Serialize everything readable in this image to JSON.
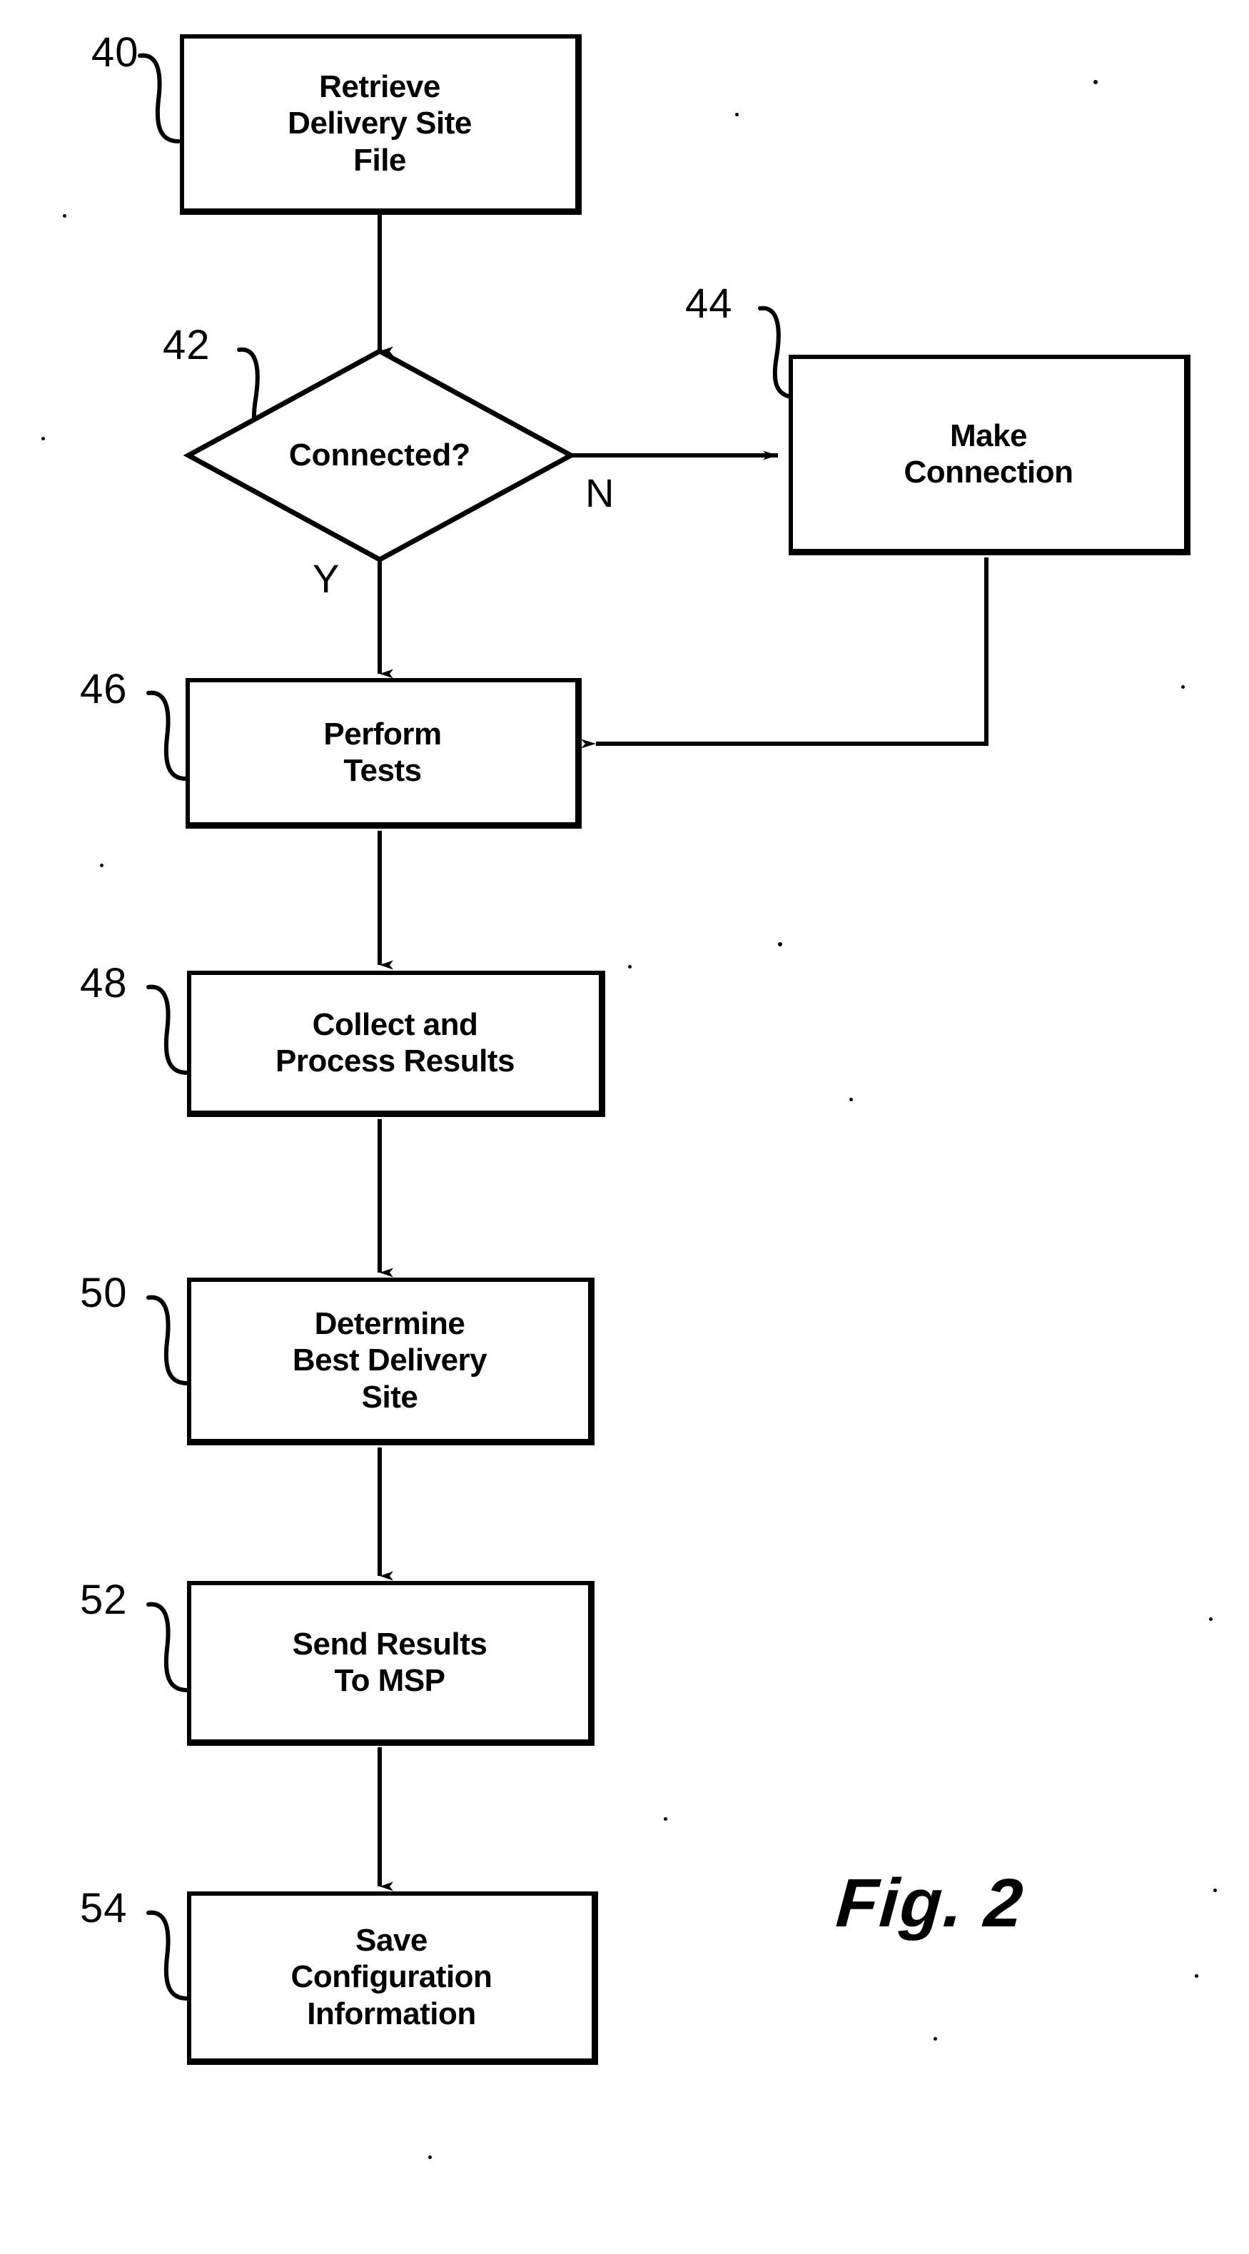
{
  "figure": {
    "caption": "Fig. 2",
    "type": "process flowchart",
    "background_color": "#ffffff",
    "ink_color": "#000000"
  },
  "nodes": [
    {
      "ref": "40",
      "shape": "process",
      "label": "Retrieve\nDelivery Site\nFile",
      "name": "retrieve-delivery-site-file"
    },
    {
      "ref": "42",
      "shape": "decision",
      "label": "Connected?",
      "name": "connected-decision"
    },
    {
      "ref": "44",
      "shape": "process",
      "label": "Make\nConnection",
      "name": "make-connection"
    },
    {
      "ref": "46",
      "shape": "process",
      "label": "Perform\nTests",
      "name": "perform-tests"
    },
    {
      "ref": "48",
      "shape": "process",
      "label": "Collect and\nProcess Results",
      "name": "collect-and-process-results"
    },
    {
      "ref": "50",
      "shape": "process",
      "label": "Determine\nBest Delivery\nSite",
      "name": "determine-best-delivery-site"
    },
    {
      "ref": "52",
      "shape": "process",
      "label": "Send Results\nTo MSP",
      "name": "send-results-to-msp"
    },
    {
      "ref": "54",
      "shape": "process",
      "label": "Save\nConfiguration\nInformation",
      "name": "save-configuration-information"
    }
  ],
  "branch_labels": {
    "yes": "Y",
    "no": "N"
  },
  "edges": [
    {
      "from": "40",
      "to": "42",
      "label": ""
    },
    {
      "from": "42",
      "to": "44",
      "label": "N"
    },
    {
      "from": "42",
      "to": "46",
      "label": "Y"
    },
    {
      "from": "44",
      "to": "46",
      "label": ""
    },
    {
      "from": "46",
      "to": "48",
      "label": ""
    },
    {
      "from": "48",
      "to": "50",
      "label": ""
    },
    {
      "from": "50",
      "to": "52",
      "label": ""
    },
    {
      "from": "52",
      "to": "54",
      "label": ""
    }
  ]
}
